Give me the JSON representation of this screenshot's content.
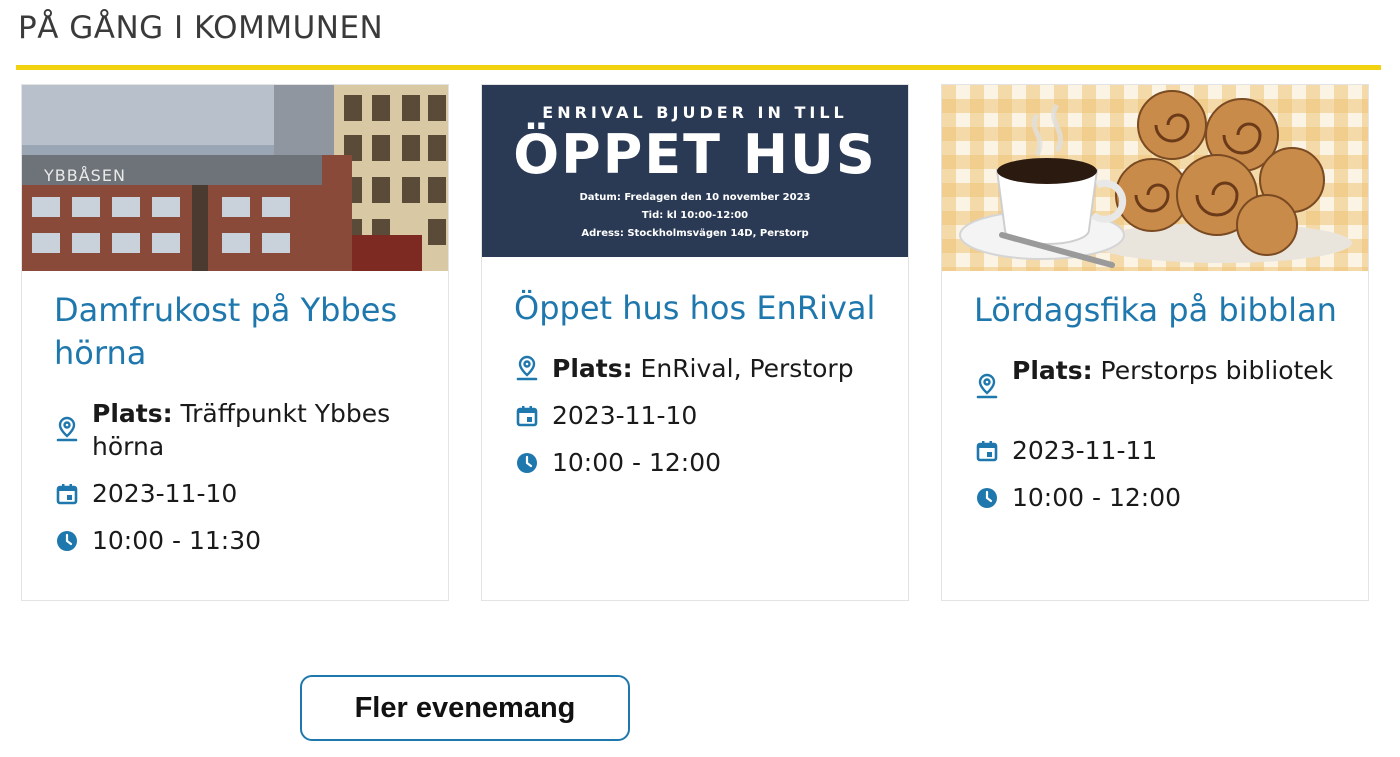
{
  "section": {
    "title": "PÅ GÅNG I KOMMUNEN"
  },
  "colors": {
    "accent": "#1f78ad",
    "divider": "#f2d20f"
  },
  "events": [
    {
      "title": "Damfrukost på Ybbes hörna",
      "place_label": "Plats:",
      "place": "Träffpunkt Ybbes hörna",
      "date": "2023-11-10",
      "time": "10:00 - 11:30",
      "image_sign": "YBBÅSEN"
    },
    {
      "title": "Öppet hus hos EnRival",
      "place_label": "Plats:",
      "place": "EnRival, Perstorp",
      "date": "2023-11-10",
      "time": "10:00 - 12:00",
      "poster": {
        "top": "ENRIVAL BJUDER IN TILL",
        "big": "ÖPPET HUS",
        "line1": "Datum: Fredagen den 10 november 2023",
        "line2": "Tid: kl 10:00-12:00",
        "line3": "Adress: Stockholmsvägen 14D, Perstorp"
      }
    },
    {
      "title": "Lördagsfika på bibblan",
      "place_label": "Plats:",
      "place": "Perstorps bibliotek",
      "date": "2023-11-11",
      "time": "10:00 - 12:00"
    }
  ],
  "icons": {
    "place": "map-pin-icon",
    "date": "calendar-icon",
    "time": "clock-icon"
  },
  "more_button": {
    "label": "Fler evenemang"
  }
}
